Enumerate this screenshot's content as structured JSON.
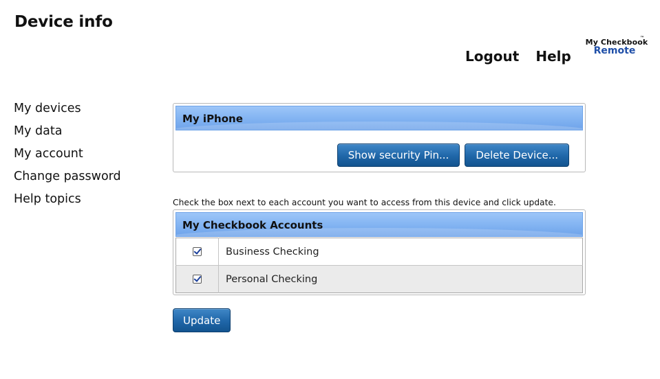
{
  "header": {
    "title": "Device info",
    "links": [
      "Logout",
      "Help"
    ]
  },
  "logo": {
    "line1": "My Checkbook",
    "tm": "™",
    "line2": "Remote"
  },
  "sidebar": {
    "items": [
      {
        "label": "My devices"
      },
      {
        "label": "My data"
      },
      {
        "label": "My account"
      },
      {
        "label": "Change password"
      },
      {
        "label": "Help topics"
      }
    ]
  },
  "device_panel": {
    "title": "My iPhone",
    "show_pin_label": "Show security Pin...",
    "delete_label": "Delete Device..."
  },
  "instruction": "Check the box next to each account you want to access from this device and click update.",
  "accounts_panel": {
    "title": "My Checkbook Accounts",
    "accounts": [
      {
        "name": "Business Checking",
        "checked": true
      },
      {
        "name": "Personal Checking",
        "checked": true
      }
    ]
  },
  "update_label": "Update",
  "colors": {
    "header_blue": "#86b6f3",
    "button_blue": "#1f66a8",
    "logo_blue": "#1f4fa8"
  }
}
